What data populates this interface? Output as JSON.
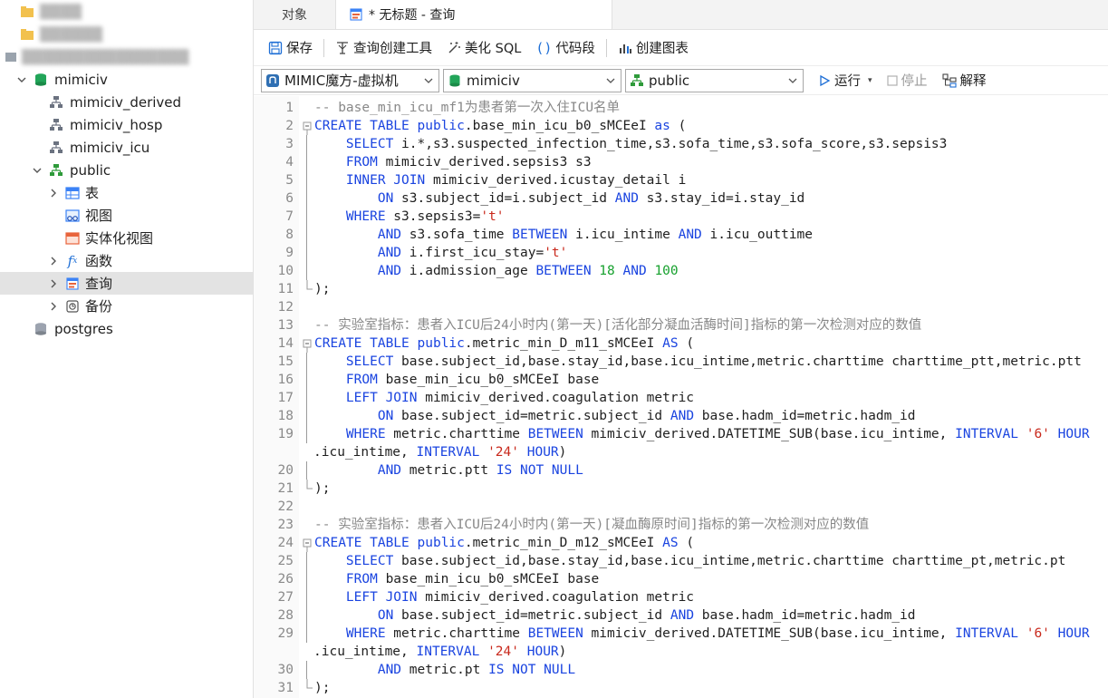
{
  "sidebar": {
    "blurred_rows": [
      {
        "label": "▒▒▒▒"
      },
      {
        "label": "▒▒▒▒▒▒"
      },
      {
        "label": "▒▒▒▒▒▒▒▒▒▒▒▒▒▒▒▒"
      }
    ],
    "tree": [
      {
        "label": "mimiciv",
        "icon": "database-icon",
        "level": 1,
        "expanded": true
      },
      {
        "label": "mimiciv_derived",
        "icon": "schema-icon",
        "level": 2
      },
      {
        "label": "mimiciv_hosp",
        "icon": "schema-icon",
        "level": 2
      },
      {
        "label": "mimiciv_icu",
        "icon": "schema-icon",
        "level": 2
      },
      {
        "label": "public",
        "icon": "schema-icon",
        "level": 2,
        "expanded": true
      },
      {
        "label": "表",
        "icon": "table-icon",
        "level": 3,
        "collapsible": true
      },
      {
        "label": "视图",
        "icon": "view-icon",
        "level": 3
      },
      {
        "label": "实体化视图",
        "icon": "materialized-view-icon",
        "level": 3
      },
      {
        "label": "函数",
        "icon": "function-icon",
        "level": 3,
        "collapsible": true
      },
      {
        "label": "查询",
        "icon": "query-icon",
        "level": 3,
        "collapsible": true,
        "selected": true
      },
      {
        "label": "备份",
        "icon": "backup-icon",
        "level": 3,
        "collapsible": true
      },
      {
        "label": "postgres",
        "icon": "database-icon-gray",
        "level": 1
      }
    ]
  },
  "tabs": [
    {
      "label": "对象",
      "active": false
    },
    {
      "label": "* 无标题 - 查询",
      "active": true
    }
  ],
  "toolbar": {
    "save": "保存",
    "query_builder": "查询创建工具",
    "beautify_sql": "美化 SQL",
    "code_snippet": "代码段",
    "create_chart": "创建图表"
  },
  "selectors": {
    "connection": "MIMIC魔方-虚拟机",
    "database": "mimiciv",
    "schema": "public",
    "run": "运行",
    "stop": "停止",
    "explain": "解释"
  },
  "editor": {
    "lines": [
      {
        "n": "1",
        "tokens": [
          [
            "cm",
            "-- base_min_icu_mf1为患者第一次入住ICU名单"
          ]
        ]
      },
      {
        "n": "2",
        "fold": "start",
        "tokens": [
          [
            "kw",
            "CREATE TABLE "
          ],
          [
            "kw",
            "public"
          ],
          [
            "pl",
            ".base_min_icu_b0_sMCEeI "
          ],
          [
            "kw",
            "as"
          ],
          [
            "pl",
            " ("
          ]
        ]
      },
      {
        "n": "3",
        "tokens": [
          [
            "pl",
            "    "
          ],
          [
            "kw",
            "SELECT"
          ],
          [
            "pl",
            " i.*,s3.suspected_infection_time,s3.sofa_time,s3.sofa_score,s3.sepsis3"
          ]
        ]
      },
      {
        "n": "4",
        "tokens": [
          [
            "pl",
            "    "
          ],
          [
            "kw",
            "FROM"
          ],
          [
            "pl",
            " mimiciv_derived.sepsis3 s3"
          ]
        ]
      },
      {
        "n": "5",
        "tokens": [
          [
            "pl",
            "    "
          ],
          [
            "kw",
            "INNER JOIN"
          ],
          [
            "pl",
            " mimiciv_derived.icustay_detail i"
          ]
        ]
      },
      {
        "n": "6",
        "tokens": [
          [
            "pl",
            "        "
          ],
          [
            "kw",
            "ON"
          ],
          [
            "pl",
            " s3.subject_id=i.subject_id "
          ],
          [
            "kw",
            "AND"
          ],
          [
            "pl",
            " s3.stay_id=i.stay_id"
          ]
        ]
      },
      {
        "n": "7",
        "tokens": [
          [
            "pl",
            "    "
          ],
          [
            "kw",
            "WHERE"
          ],
          [
            "pl",
            " s3.sepsis3="
          ],
          [
            "st",
            "'t'"
          ]
        ]
      },
      {
        "n": "8",
        "tokens": [
          [
            "pl",
            "        "
          ],
          [
            "kw",
            "AND"
          ],
          [
            "pl",
            " s3.sofa_time "
          ],
          [
            "kw",
            "BETWEEN"
          ],
          [
            "pl",
            " i.icu_intime "
          ],
          [
            "kw",
            "AND"
          ],
          [
            "pl",
            " i.icu_outtime"
          ]
        ]
      },
      {
        "n": "9",
        "tokens": [
          [
            "pl",
            "        "
          ],
          [
            "kw",
            "AND"
          ],
          [
            "pl",
            " i.first_icu_stay="
          ],
          [
            "st",
            "'t'"
          ]
        ]
      },
      {
        "n": "10",
        "tokens": [
          [
            "pl",
            "        "
          ],
          [
            "kw",
            "AND"
          ],
          [
            "pl",
            " i.admission_age "
          ],
          [
            "kw",
            "BETWEEN"
          ],
          [
            "pl",
            " "
          ],
          [
            "nm",
            "18"
          ],
          [
            "pl",
            " "
          ],
          [
            "kw",
            "AND"
          ],
          [
            "pl",
            " "
          ],
          [
            "nm",
            "100"
          ]
        ]
      },
      {
        "n": "11",
        "fold": "end",
        "tokens": [
          [
            "pl",
            ");"
          ]
        ]
      },
      {
        "n": "12",
        "tokens": []
      },
      {
        "n": "13",
        "tokens": [
          [
            "cm",
            "-- 实验室指标：患者入ICU后24小时内(第一天)[活化部分凝血活酶时间]指标的第一次检测对应的数值"
          ]
        ]
      },
      {
        "n": "14",
        "fold": "start",
        "tokens": [
          [
            "kw",
            "CREATE TABLE "
          ],
          [
            "kw",
            "public"
          ],
          [
            "pl",
            ".metric_min_D_m11_sMCEeI "
          ],
          [
            "kw",
            "AS"
          ],
          [
            "pl",
            " ("
          ]
        ]
      },
      {
        "n": "15",
        "tokens": [
          [
            "pl",
            "    "
          ],
          [
            "kw",
            "SELECT"
          ],
          [
            "pl",
            " base.subject_id,base.stay_id,base.icu_intime,metric.charttime charttime_ptt,metric.ptt"
          ]
        ]
      },
      {
        "n": "16",
        "tokens": [
          [
            "pl",
            "    "
          ],
          [
            "kw",
            "FROM"
          ],
          [
            "pl",
            " base_min_icu_b0_sMCEeI base"
          ]
        ]
      },
      {
        "n": "17",
        "tokens": [
          [
            "pl",
            "    "
          ],
          [
            "kw",
            "LEFT JOIN"
          ],
          [
            "pl",
            " mimiciv_derived.coagulation metric"
          ]
        ]
      },
      {
        "n": "18",
        "tokens": [
          [
            "pl",
            "        "
          ],
          [
            "kw",
            "ON"
          ],
          [
            "pl",
            " base.subject_id=metric.subject_id "
          ],
          [
            "kw",
            "AND"
          ],
          [
            "pl",
            " base.hadm_id=metric.hadm_id"
          ]
        ]
      },
      {
        "n": "19",
        "tokens": [
          [
            "pl",
            "    "
          ],
          [
            "kw",
            "WHERE"
          ],
          [
            "pl",
            " metric.charttime "
          ],
          [
            "kw",
            "BETWEEN"
          ],
          [
            "pl",
            " mimiciv_derived.DATETIME_SUB(base.icu_intime, "
          ],
          [
            "kw",
            "INTERVAL"
          ],
          [
            "pl",
            " "
          ],
          [
            "st",
            "'6'"
          ],
          [
            "pl",
            " "
          ],
          [
            "kw",
            "HOUR"
          ]
        ]
      },
      {
        "n": "",
        "tokens": [
          [
            "pl",
            ".icu_intime, "
          ],
          [
            "kw",
            "INTERVAL"
          ],
          [
            "pl",
            " "
          ],
          [
            "st",
            "'24'"
          ],
          [
            "pl",
            " "
          ],
          [
            "kw",
            "HOUR"
          ],
          [
            "pl",
            ")"
          ]
        ],
        "wrap": true
      },
      {
        "n": "20",
        "tokens": [
          [
            "pl",
            "        "
          ],
          [
            "kw",
            "AND"
          ],
          [
            "pl",
            " metric.ptt "
          ],
          [
            "kw",
            "IS NOT NULL"
          ]
        ]
      },
      {
        "n": "21",
        "fold": "end",
        "tokens": [
          [
            "pl",
            ");"
          ]
        ]
      },
      {
        "n": "22",
        "tokens": []
      },
      {
        "n": "23",
        "tokens": [
          [
            "cm",
            "-- 实验室指标：患者入ICU后24小时内(第一天)[凝血酶原时间]指标的第一次检测对应的数值"
          ]
        ]
      },
      {
        "n": "24",
        "fold": "start",
        "tokens": [
          [
            "kw",
            "CREATE TABLE "
          ],
          [
            "kw",
            "public"
          ],
          [
            "pl",
            ".metric_min_D_m12_sMCEeI "
          ],
          [
            "kw",
            "AS"
          ],
          [
            "pl",
            " ("
          ]
        ]
      },
      {
        "n": "25",
        "tokens": [
          [
            "pl",
            "    "
          ],
          [
            "kw",
            "SELECT"
          ],
          [
            "pl",
            " base.subject_id,base.stay_id,base.icu_intime,metric.charttime charttime_pt,metric.pt"
          ]
        ]
      },
      {
        "n": "26",
        "tokens": [
          [
            "pl",
            "    "
          ],
          [
            "kw",
            "FROM"
          ],
          [
            "pl",
            " base_min_icu_b0_sMCEeI base"
          ]
        ]
      },
      {
        "n": "27",
        "tokens": [
          [
            "pl",
            "    "
          ],
          [
            "kw",
            "LEFT JOIN"
          ],
          [
            "pl",
            " mimiciv_derived.coagulation metric"
          ]
        ]
      },
      {
        "n": "28",
        "tokens": [
          [
            "pl",
            "        "
          ],
          [
            "kw",
            "ON"
          ],
          [
            "pl",
            " base.subject_id=metric.subject_id "
          ],
          [
            "kw",
            "AND"
          ],
          [
            "pl",
            " base.hadm_id=metric.hadm_id"
          ]
        ]
      },
      {
        "n": "29",
        "tokens": [
          [
            "pl",
            "    "
          ],
          [
            "kw",
            "WHERE"
          ],
          [
            "pl",
            " metric.charttime "
          ],
          [
            "kw",
            "BETWEEN"
          ],
          [
            "pl",
            " mimiciv_derived.DATETIME_SUB(base.icu_intime, "
          ],
          [
            "kw",
            "INTERVAL"
          ],
          [
            "pl",
            " "
          ],
          [
            "st",
            "'6'"
          ],
          [
            "pl",
            " "
          ],
          [
            "kw",
            "HOUR"
          ]
        ]
      },
      {
        "n": "",
        "tokens": [
          [
            "pl",
            ".icu_intime, "
          ],
          [
            "kw",
            "INTERVAL"
          ],
          [
            "pl",
            " "
          ],
          [
            "st",
            "'24'"
          ],
          [
            "pl",
            " "
          ],
          [
            "kw",
            "HOUR"
          ],
          [
            "pl",
            ")"
          ]
        ],
        "wrap": true
      },
      {
        "n": "30",
        "tokens": [
          [
            "pl",
            "        "
          ],
          [
            "kw",
            "AND"
          ],
          [
            "pl",
            " metric.pt "
          ],
          [
            "kw",
            "IS NOT NULL"
          ]
        ]
      },
      {
        "n": "31",
        "fold": "end",
        "tokens": [
          [
            "pl",
            ");"
          ]
        ]
      }
    ]
  },
  "colors": {
    "keyword": "#1a44e0",
    "comment": "#888888",
    "string": "#c9291c",
    "number": "#17a12e",
    "database": "#1f9d55",
    "schema": "#2e9a3a"
  }
}
